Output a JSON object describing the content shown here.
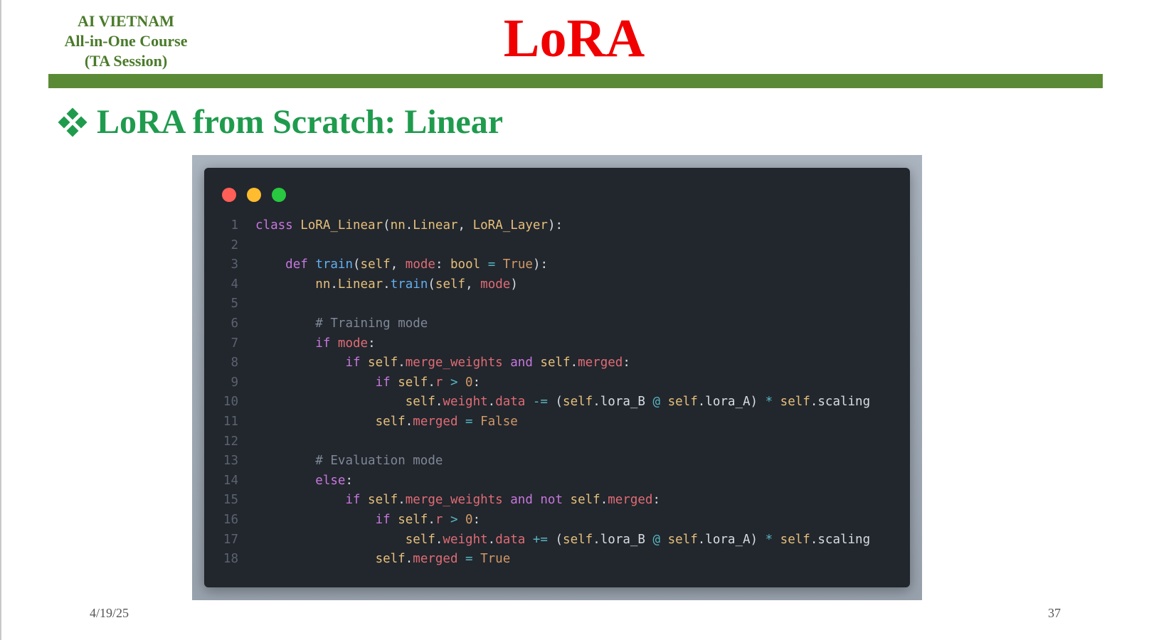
{
  "header": {
    "org_lines": [
      "AI VIETNAM",
      "All-in-One Course",
      "(TA Session)"
    ],
    "title": "LoRA"
  },
  "section": {
    "heading": "LoRA from Scratch: Linear",
    "bullet_icon": "four-diamonds-icon"
  },
  "code_window": {
    "dots": [
      "close-dot",
      "minimize-dot",
      "maximize-dot"
    ],
    "lines": [
      {
        "n": "1",
        "tokens": [
          [
            "kw",
            "class "
          ],
          [
            "cls",
            "LoRA_Linear"
          ],
          [
            "pn",
            "("
          ],
          [
            "cls",
            "nn"
          ],
          [
            "pn",
            "."
          ],
          [
            "cls",
            "Linear"
          ],
          [
            "pn",
            ", "
          ],
          [
            "cls",
            "LoRA_Layer"
          ],
          [
            "pn",
            "):"
          ]
        ]
      },
      {
        "n": "2",
        "tokens": []
      },
      {
        "n": "3",
        "tokens": [
          [
            "plain",
            "    "
          ],
          [
            "kw",
            "def "
          ],
          [
            "fn",
            "train"
          ],
          [
            "pn",
            "("
          ],
          [
            "self",
            "self"
          ],
          [
            "pn",
            ", "
          ],
          [
            "attr",
            "mode"
          ],
          [
            "pn",
            ": "
          ],
          [
            "cls",
            "bool"
          ],
          [
            "op",
            " = "
          ],
          [
            "num",
            "True"
          ],
          [
            "pn",
            "):"
          ]
        ]
      },
      {
        "n": "4",
        "tokens": [
          [
            "plain",
            "        "
          ],
          [
            "cls",
            "nn"
          ],
          [
            "pn",
            "."
          ],
          [
            "cls",
            "Linear"
          ],
          [
            "pn",
            "."
          ],
          [
            "fn",
            "train"
          ],
          [
            "pn",
            "("
          ],
          [
            "self",
            "self"
          ],
          [
            "pn",
            ", "
          ],
          [
            "attr",
            "mode"
          ],
          [
            "pn",
            ")"
          ]
        ]
      },
      {
        "n": "5",
        "tokens": []
      },
      {
        "n": "6",
        "tokens": [
          [
            "plain",
            "        "
          ],
          [
            "cm",
            "# Training mode"
          ]
        ]
      },
      {
        "n": "7",
        "tokens": [
          [
            "plain",
            "        "
          ],
          [
            "kw",
            "if "
          ],
          [
            "attr",
            "mode"
          ],
          [
            "pn",
            ":"
          ]
        ]
      },
      {
        "n": "8",
        "tokens": [
          [
            "plain",
            "            "
          ],
          [
            "kw",
            "if "
          ],
          [
            "self",
            "self"
          ],
          [
            "pn",
            "."
          ],
          [
            "attr",
            "merge_weights"
          ],
          [
            "kw",
            " and "
          ],
          [
            "self",
            "self"
          ],
          [
            "pn",
            "."
          ],
          [
            "attr",
            "merged"
          ],
          [
            "pn",
            ":"
          ]
        ]
      },
      {
        "n": "9",
        "tokens": [
          [
            "plain",
            "                "
          ],
          [
            "kw",
            "if "
          ],
          [
            "self",
            "self"
          ],
          [
            "pn",
            "."
          ],
          [
            "attr",
            "r"
          ],
          [
            "op",
            " > "
          ],
          [
            "num",
            "0"
          ],
          [
            "pn",
            ":"
          ]
        ]
      },
      {
        "n": "10",
        "tokens": [
          [
            "plain",
            "                    "
          ],
          [
            "self",
            "self"
          ],
          [
            "pn",
            "."
          ],
          [
            "attr",
            "weight"
          ],
          [
            "pn",
            "."
          ],
          [
            "attr",
            "data"
          ],
          [
            "op",
            " -= "
          ],
          [
            "pn",
            "("
          ],
          [
            "self",
            "self"
          ],
          [
            "pn",
            "."
          ],
          [
            "plain",
            "lora_B "
          ],
          [
            "op",
            "@ "
          ],
          [
            "self",
            "self"
          ],
          [
            "pn",
            "."
          ],
          [
            "plain",
            "lora_A"
          ],
          [
            "pn",
            ") "
          ],
          [
            "op",
            "* "
          ],
          [
            "self",
            "self"
          ],
          [
            "pn",
            "."
          ],
          [
            "plain",
            "scaling"
          ]
        ]
      },
      {
        "n": "11",
        "tokens": [
          [
            "plain",
            "                "
          ],
          [
            "self",
            "self"
          ],
          [
            "pn",
            "."
          ],
          [
            "attr",
            "merged"
          ],
          [
            "op",
            " = "
          ],
          [
            "num",
            "False"
          ]
        ]
      },
      {
        "n": "12",
        "tokens": []
      },
      {
        "n": "13",
        "tokens": [
          [
            "plain",
            "        "
          ],
          [
            "cm",
            "# Evaluation mode"
          ]
        ]
      },
      {
        "n": "14",
        "tokens": [
          [
            "plain",
            "        "
          ],
          [
            "kw",
            "else"
          ],
          [
            "pn",
            ":"
          ]
        ]
      },
      {
        "n": "15",
        "tokens": [
          [
            "plain",
            "            "
          ],
          [
            "kw",
            "if "
          ],
          [
            "self",
            "self"
          ],
          [
            "pn",
            "."
          ],
          [
            "attr",
            "merge_weights"
          ],
          [
            "kw",
            " and not "
          ],
          [
            "self",
            "self"
          ],
          [
            "pn",
            "."
          ],
          [
            "attr",
            "merged"
          ],
          [
            "pn",
            ":"
          ]
        ]
      },
      {
        "n": "16",
        "tokens": [
          [
            "plain",
            "                "
          ],
          [
            "kw",
            "if "
          ],
          [
            "self",
            "self"
          ],
          [
            "pn",
            "."
          ],
          [
            "attr",
            "r"
          ],
          [
            "op",
            " > "
          ],
          [
            "num",
            "0"
          ],
          [
            "pn",
            ":"
          ]
        ]
      },
      {
        "n": "17",
        "tokens": [
          [
            "plain",
            "                    "
          ],
          [
            "self",
            "self"
          ],
          [
            "pn",
            "."
          ],
          [
            "attr",
            "weight"
          ],
          [
            "pn",
            "."
          ],
          [
            "attr",
            "data"
          ],
          [
            "op",
            " += "
          ],
          [
            "pn",
            "("
          ],
          [
            "self",
            "self"
          ],
          [
            "pn",
            "."
          ],
          [
            "plain",
            "lora_B "
          ],
          [
            "op",
            "@ "
          ],
          [
            "self",
            "self"
          ],
          [
            "pn",
            "."
          ],
          [
            "plain",
            "lora_A"
          ],
          [
            "pn",
            ") "
          ],
          [
            "op",
            "* "
          ],
          [
            "self",
            "self"
          ],
          [
            "pn",
            "."
          ],
          [
            "plain",
            "scaling"
          ]
        ]
      },
      {
        "n": "18",
        "tokens": [
          [
            "plain",
            "                "
          ],
          [
            "self",
            "self"
          ],
          [
            "pn",
            "."
          ],
          [
            "attr",
            "merged"
          ],
          [
            "op",
            " = "
          ],
          [
            "num",
            "True"
          ]
        ]
      }
    ]
  },
  "footer": {
    "date": "4/19/25",
    "page_number": "37"
  },
  "colors": {
    "org_text": "#4a7a2a",
    "title_red": "#f00000",
    "bar_green": "#5b8a36",
    "heading_green": "#1f9b4d",
    "code_bg": "#22262d"
  }
}
